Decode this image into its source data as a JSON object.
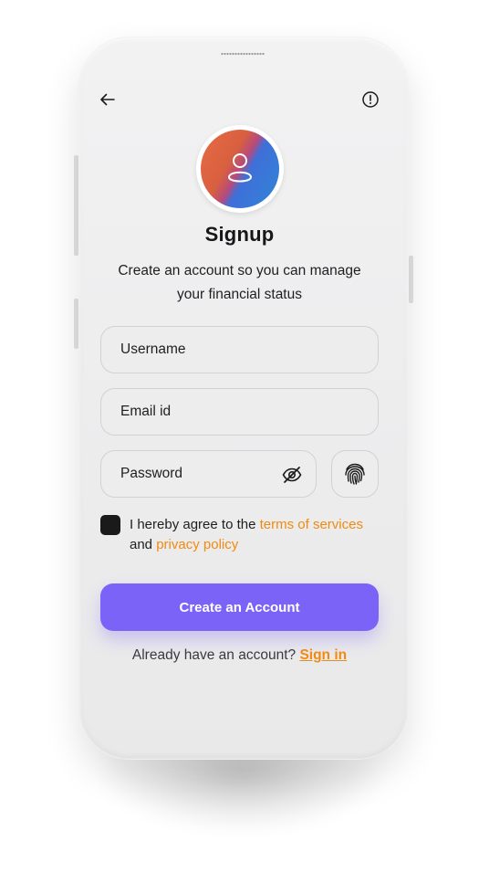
{
  "header": {
    "back_icon": "arrow-left-icon",
    "info_icon": "alert-circle-icon"
  },
  "avatar": {
    "icon": "user-icon"
  },
  "title": "Signup",
  "subtitle_line1": "Create an account so you can manage",
  "subtitle_line2": "your financial status",
  "form": {
    "username_placeholder": "Username",
    "email_placeholder": "Email id",
    "password_placeholder": "Password",
    "password_toggle_icon": "eye-off-icon",
    "biometric_icon": "fingerprint-icon"
  },
  "agreement": {
    "checked": true,
    "prefix": "I hereby agree to the ",
    "terms_link": "terms of services",
    "and_text": "and ",
    "privacy_link": "privacy policy"
  },
  "primary_button": "Create an Account",
  "footer": {
    "prompt": "Already have an account? ",
    "signin_link": "Sign in"
  },
  "colors": {
    "accent": "#7b63f7",
    "link": "#f08a12",
    "checkbox": "#1a1a1a",
    "background": "#ededee"
  }
}
